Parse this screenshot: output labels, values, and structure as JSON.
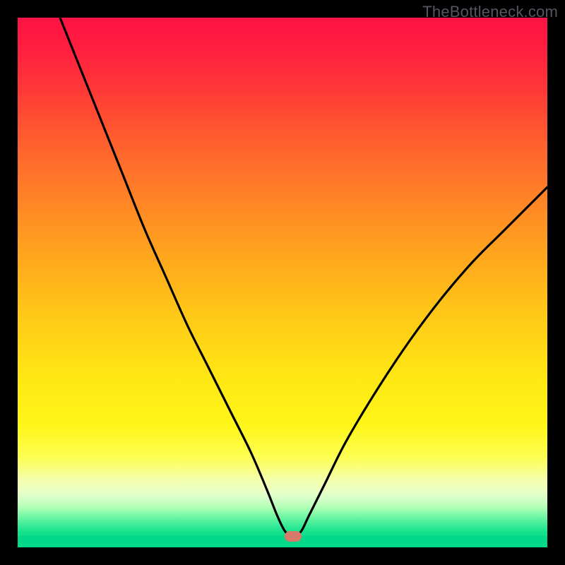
{
  "watermark": "TheBottleneck.com",
  "colors": {
    "frame": "#000000",
    "curve": "#000000",
    "blob": "#d77a6a",
    "gradient_top": "#ff1344",
    "gradient_bottom": "#02d988"
  },
  "chart_data": {
    "type": "line",
    "title": "",
    "xlabel": "",
    "ylabel": "",
    "xlim": [
      0,
      100
    ],
    "ylim": [
      0,
      100
    ],
    "grid": false,
    "legend": null,
    "annotations": [
      {
        "type": "marker",
        "shape": "pill",
        "x": 52,
        "y": 2,
        "color": "#d77a6a"
      }
    ],
    "series": [
      {
        "name": "bottleneck-curve",
        "x": [
          8,
          12,
          16,
          20,
          24,
          28,
          32,
          36,
          40,
          44,
          47,
          49,
          50.5,
          52,
          53.5,
          55,
          58,
          62,
          68,
          74,
          80,
          86,
          92,
          98,
          100
        ],
        "y": [
          100,
          90,
          80,
          70,
          60,
          51,
          42,
          34,
          26,
          18,
          11,
          6,
          3,
          2,
          3,
          6,
          12,
          20,
          30,
          39,
          47,
          54,
          60,
          66,
          68
        ]
      }
    ]
  }
}
